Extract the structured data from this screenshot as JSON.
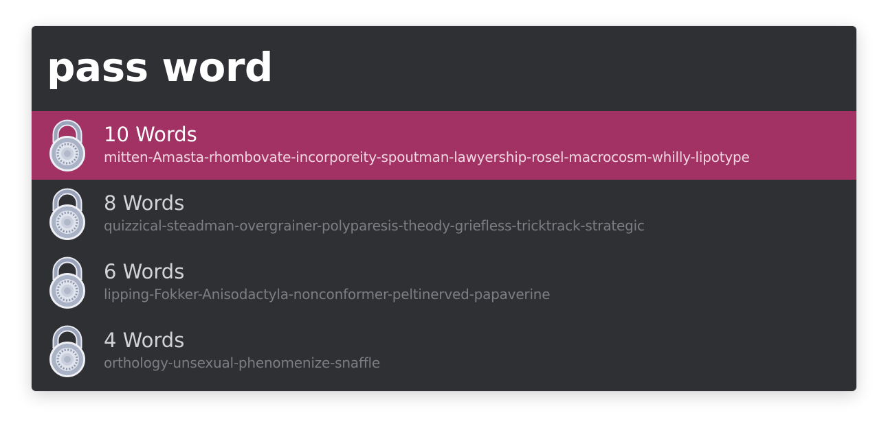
{
  "search": {
    "query": "pass word"
  },
  "results": [
    {
      "title": "10 Words",
      "subtitle": "mitten-Amasta-rhombovate-incorporeity-spoutman-lawyership-rosel-macrocosm-whilly-lipotype",
      "icon": "padlock-icon",
      "selected": true
    },
    {
      "title": "8 Words",
      "subtitle": "quizzical-steadman-overgrainer-polyparesis-theody-griefless-tricktrack-strategic",
      "icon": "padlock-icon",
      "selected": false
    },
    {
      "title": "6 Words",
      "subtitle": "lipping-Fokker-Anisodactyla-nonconformer-peltinerved-papaverine",
      "icon": "padlock-icon",
      "selected": false
    },
    {
      "title": "4 Words",
      "subtitle": "orthology-unsexual-phenomenize-snaffle",
      "icon": "padlock-icon",
      "selected": false
    }
  ],
  "colors": {
    "window_background": "#2f3033",
    "selection": "#a13263"
  }
}
